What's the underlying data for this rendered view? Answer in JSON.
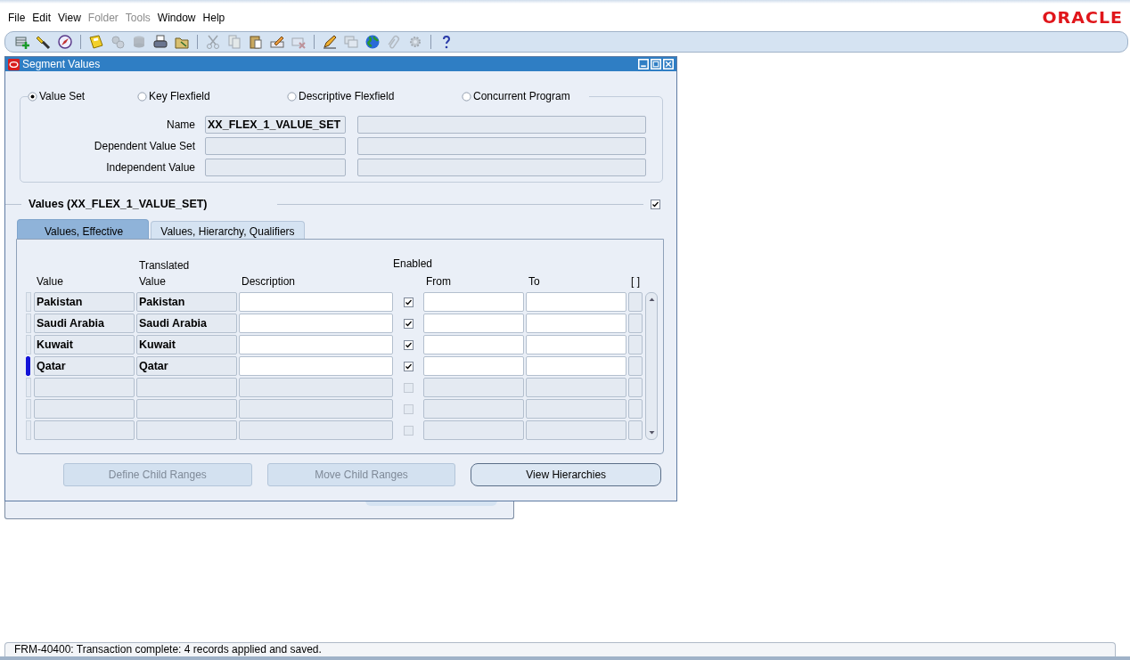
{
  "menu": [
    {
      "label": "File",
      "disabled": false
    },
    {
      "label": "Edit",
      "disabled": false
    },
    {
      "label": "View",
      "disabled": false
    },
    {
      "label": "Folder",
      "disabled": true
    },
    {
      "label": "Tools",
      "disabled": true
    },
    {
      "label": "Window",
      "disabled": false
    },
    {
      "label": "Help",
      "disabled": false
    }
  ],
  "logo": "ORACLE",
  "toolbar": [
    {
      "kind": "button",
      "disabled": false
    },
    {
      "kind": "button",
      "disabled": false
    },
    {
      "kind": "button",
      "disabled": false
    },
    {
      "kind": "separator"
    },
    {
      "kind": "button",
      "disabled": false
    },
    {
      "kind": "button",
      "disabled": true
    },
    {
      "kind": "button",
      "disabled": true
    },
    {
      "kind": "button",
      "disabled": false
    },
    {
      "kind": "button",
      "disabled": false
    },
    {
      "kind": "separator"
    },
    {
      "kind": "button",
      "disabled": true
    },
    {
      "kind": "button",
      "disabled": true
    },
    {
      "kind": "button",
      "disabled": false
    },
    {
      "kind": "button",
      "disabled": false
    },
    {
      "kind": "button",
      "disabled": true
    },
    {
      "kind": "separator"
    },
    {
      "kind": "button",
      "disabled": false
    },
    {
      "kind": "button",
      "disabled": true
    },
    {
      "kind": "button",
      "disabled": false
    },
    {
      "kind": "button",
      "disabled": true
    },
    {
      "kind": "button",
      "disabled": true
    },
    {
      "kind": "separator"
    },
    {
      "kind": "button",
      "disabled": false
    }
  ],
  "window": {
    "title": "Segment Values"
  },
  "scope_options": [
    {
      "label": "Value Set",
      "selected": true
    },
    {
      "label": "Key Flexfield",
      "selected": false
    },
    {
      "label": "Descriptive Flexfield",
      "selected": false
    },
    {
      "label": "Concurrent Program",
      "selected": false
    }
  ],
  "fields": [
    {
      "label": "Name",
      "value": "XX_FLEX_1_VALUE_SET"
    },
    {
      "label": "Dependent Value Set"
    },
    {
      "label": "Independent Value"
    }
  ],
  "values_section": {
    "title": "Values (XX_FLEX_1_VALUE_SET)",
    "checked": true
  },
  "tabs": [
    {
      "label": "Values, Effective",
      "selected": true
    },
    {
      "label": "Values, Hierarchy, Qualifiers",
      "selected": false
    }
  ],
  "table": {
    "columns": [
      "Value",
      "Translated Value",
      "Description",
      "Enabled",
      "From",
      "To",
      "[ ]"
    ],
    "rows": [
      {
        "kind": "record",
        "value": "Pakistan",
        "translated_value": "Pakistan",
        "enabled": true,
        "current": false
      },
      {
        "kind": "record",
        "value": "Saudi Arabia",
        "translated_value": "Saudi Arabia",
        "enabled": true,
        "current": false
      },
      {
        "kind": "record",
        "value": "Kuwait",
        "translated_value": "Kuwait",
        "enabled": true,
        "current": false
      },
      {
        "kind": "record",
        "value": "Qatar",
        "translated_value": "Qatar",
        "enabled": true,
        "current": true
      },
      {
        "kind": "empty",
        "enabled": false
      },
      {
        "kind": "empty",
        "enabled": false
      },
      {
        "kind": "empty",
        "enabled": false
      }
    ]
  },
  "buttons": [
    {
      "label": "Define Child Ranges",
      "disabled": true
    },
    {
      "label": "Move Child Ranges",
      "disabled": true
    },
    {
      "label": "View Hierarchies",
      "disabled": false
    }
  ],
  "status_bar": "FRM-40400: Transaction complete: 4 records applied and saved."
}
